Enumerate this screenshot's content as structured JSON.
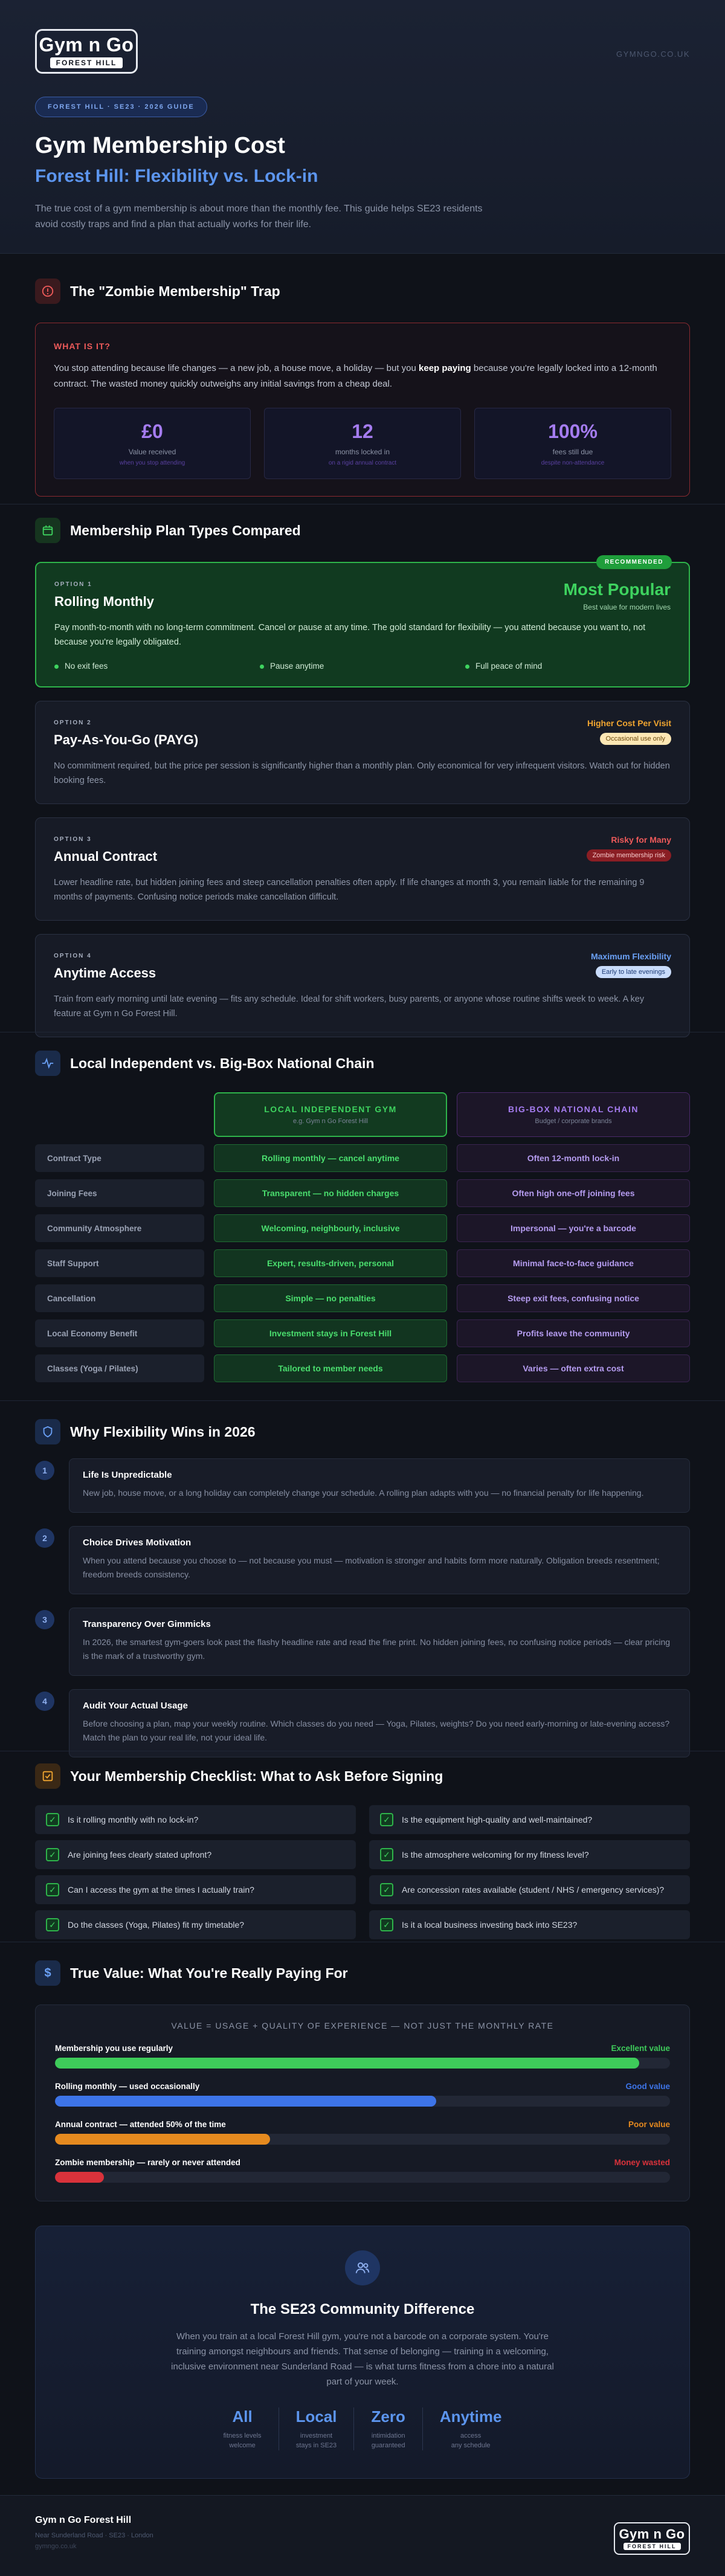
{
  "header": {
    "logo_main": "Gym n Go",
    "logo_sub": "FOREST HILL",
    "site_url": "GYMNGO.CO.UK",
    "pill": "FOREST HILL · SE23 · 2026 GUIDE",
    "title": "Gym Membership Cost",
    "subtitle": "Forest Hill: Flexibility vs. Lock-in",
    "intro": "The true cost of a gym membership is about more than the monthly fee. This guide helps SE23 residents avoid costly traps and find a plan that actually works for their life."
  },
  "zombie": {
    "title": "The \"Zombie Membership\" Trap",
    "label": "WHAT IS IT?",
    "text_a": "You stop attending because life changes — a new job, a house move, a holiday — but you ",
    "text_bold": "keep paying",
    "text_b": " because you're legally locked into a 12-month contract. The wasted money quickly outweighs any initial savings from a cheap deal.",
    "stats": [
      {
        "value": "£0",
        "label": "Value received",
        "sub": "when you stop attending"
      },
      {
        "value": "12",
        "label": "months locked in",
        "sub": "on a rigid annual contract"
      },
      {
        "value": "100%",
        "label": "fees still due",
        "sub": "despite non-attendance"
      }
    ]
  },
  "plans": {
    "title": "Membership Plan Types Compared",
    "rec_badge": "RECOMMENDED",
    "items": [
      {
        "option": "OPTION 1",
        "title": "Rolling Monthly",
        "right_title": "Most Popular",
        "right_sub": "Best value for modern lives",
        "desc": "Pay month-to-month with no long-term commitment. Cancel or pause at any time. The gold standard for flexibility — you attend because you want to, not because you're legally obligated.",
        "checks": [
          "No exit fees",
          "Pause anytime",
          "Full peace of mind"
        ]
      },
      {
        "option": "OPTION 2",
        "title": "Pay-As-You-Go (PAYG)",
        "right_title": "Higher Cost Per Visit",
        "right_sub": "Occasional use only",
        "desc": "No commitment required, but the price per session is significantly higher than a monthly plan. Only economical for very infrequent visitors. Watch out for hidden booking fees."
      },
      {
        "option": "OPTION 3",
        "title": "Annual Contract",
        "right_title": "Risky for Many",
        "right_sub": "Zombie membership risk",
        "desc": "Lower headline rate, but hidden joining fees and steep cancellation penalties often apply. If life changes at month 3, you remain liable for the remaining 9 months of payments. Confusing notice periods make cancellation difficult."
      },
      {
        "option": "OPTION 4",
        "title": "Anytime Access",
        "right_title": "Maximum Flexibility",
        "right_sub": "Early to late evenings",
        "desc": "Train from early morning until late evening — fits any schedule. Ideal for shift workers, busy parents, or anyone whose routine shifts week to week. A key feature at Gym n Go Forest Hill."
      }
    ]
  },
  "compare": {
    "title": "Local Independent vs. Big-Box National Chain",
    "col_a": "LOCAL INDEPENDENT GYM",
    "col_a_sub": "e.g. Gym n Go Forest Hill",
    "col_b": "BIG-BOX NATIONAL CHAIN",
    "col_b_sub": "Budget / corporate brands",
    "rows": [
      {
        "label": "Contract Type",
        "a": "Rolling monthly — cancel anytime",
        "b": "Often 12-month lock-in"
      },
      {
        "label": "Joining Fees",
        "a": "Transparent — no hidden charges",
        "b": "Often high one-off joining fees"
      },
      {
        "label": "Community Atmosphere",
        "a": "Welcoming, neighbourly, inclusive",
        "b": "Impersonal — you're a barcode"
      },
      {
        "label": "Staff Support",
        "a": "Expert, results-driven, personal",
        "b": "Minimal face-to-face guidance"
      },
      {
        "label": "Cancellation",
        "a": "Simple — no penalties",
        "b": "Steep exit fees, confusing notice"
      },
      {
        "label": "Local Economy Benefit",
        "a": "Investment stays in Forest Hill",
        "b": "Profits leave the community"
      },
      {
        "label": "Classes (Yoga / Pilates)",
        "a": "Tailored to member needs",
        "b": "Varies — often extra cost"
      }
    ]
  },
  "why": {
    "title": "Why Flexibility Wins in 2026",
    "items": [
      {
        "num": "1",
        "title": "Life Is Unpredictable",
        "desc": "New job, house move, or a long holiday can completely change your schedule. A rolling plan adapts with you — no financial penalty for life happening."
      },
      {
        "num": "2",
        "title": "Choice Drives Motivation",
        "desc": "When you attend because you choose to — not because you must — motivation is stronger and habits form more naturally. Obligation breeds resentment; freedom breeds consistency."
      },
      {
        "num": "3",
        "title": "Transparency Over Gimmicks",
        "desc": "In 2026, the smartest gym-goers look past the flashy headline rate and read the fine print. No hidden joining fees, no confusing notice periods — clear pricing is the mark of a trustworthy gym."
      },
      {
        "num": "4",
        "title": "Audit Your Actual Usage",
        "desc": "Before choosing a plan, map your weekly routine. Which classes do you need — Yoga, Pilates, weights? Do you need early-morning or late-evening access? Match the plan to your real life, not your ideal life."
      }
    ]
  },
  "checklist": {
    "title": "Your Membership Checklist: What to Ask Before Signing",
    "items": [
      "Is it rolling monthly with no lock-in?",
      "Is the equipment high-quality and well-maintained?",
      "Are joining fees clearly stated upfront?",
      "Is the atmosphere welcoming for my fitness level?",
      "Can I access the gym at the times I actually train?",
      "Are concession rates available (student / NHS / emergency services)?",
      "Do the classes (Yoga, Pilates) fit my timetable?",
      "Is it a local business investing back into SE23?"
    ]
  },
  "value": {
    "title": "True Value: What You're Really Paying For",
    "caption": "VALUE = USAGE + QUALITY OF EXPERIENCE — NOT JUST THE MONTHLY RATE",
    "bars": [
      {
        "label": "Membership you use regularly",
        "rating": "Excellent value",
        "fill": 0.95,
        "color": "#3ecb5a"
      },
      {
        "label": "Rolling monthly — used occasionally",
        "rating": "Good value",
        "fill": 0.62,
        "color": "#3d74e8"
      },
      {
        "label": "Annual contract — attended 50% of the time",
        "rating": "Poor value",
        "fill": 0.35,
        "color": "#e58a1f"
      },
      {
        "label": "Zombie membership — rarely or never attended",
        "rating": "Money wasted",
        "fill": 0.08,
        "color": "#d9323b"
      }
    ]
  },
  "community": {
    "title": "The SE23 Community Difference",
    "desc": "When you train at a local Forest Hill gym, you're not a barcode on a corporate system. You're training amongst neighbours and friends. That sense of belonging — training in a welcoming, inclusive environment near Sunderland Road — is what turns fitness from a chore into a natural part of your week.",
    "stats": [
      {
        "value": "All",
        "l1": "fitness levels",
        "l2": "welcome"
      },
      {
        "value": "Local",
        "l1": "investment",
        "l2": "stays in SE23"
      },
      {
        "value": "Zero",
        "l1": "intimidation",
        "l2": "guaranteed"
      },
      {
        "value": "Anytime",
        "l1": "access",
        "l2": "any schedule"
      }
    ]
  },
  "footer": {
    "name": "Gym n Go Forest Hill",
    "address": "Near Sunderland Road · SE23 · London",
    "url": "gymngo.co.uk"
  }
}
